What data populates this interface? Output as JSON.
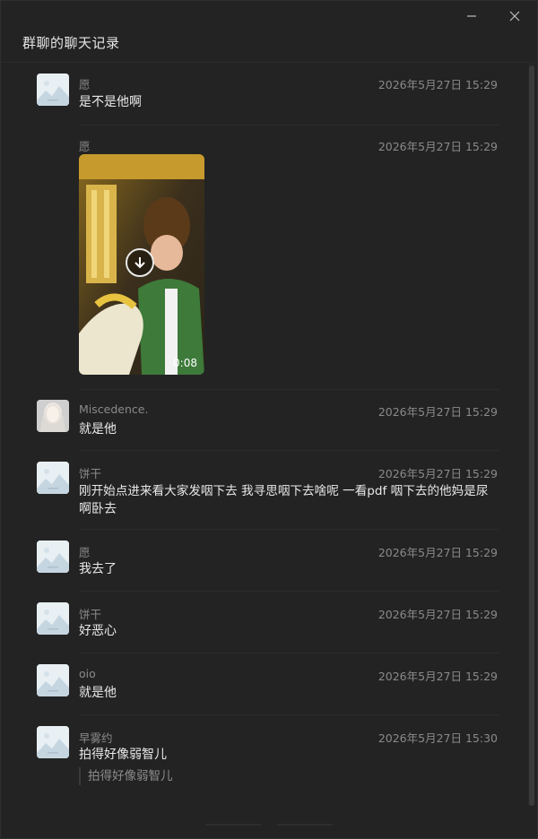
{
  "window": {
    "title": "群聊的聊天记录"
  },
  "messages": [
    {
      "sender": "愿",
      "time": "2026年5月27日 15:29",
      "text": "是不是他啊",
      "avatar": "placeholder-avatar"
    },
    {
      "sender": "愿",
      "time": "2026年5月27日 15:29",
      "video_duration": "0:08"
    },
    {
      "sender": "Miscedence.",
      "time": "2026年5月27日 15:29",
      "text": "就是他",
      "avatar": "photo-avatar"
    },
    {
      "sender": "饼干",
      "time": "2026年5月27日 15:29",
      "text_line1": "刚开始点进来看大家发咽下去 我寻思咽下去啥呢 一看pdf 咽下去的他妈是尿",
      "text_line2": "啊卧去",
      "avatar": "placeholder-avatar"
    },
    {
      "sender": "愿",
      "time": "2026年5月27日 15:29",
      "text": "我去了",
      "avatar": "placeholder-avatar"
    },
    {
      "sender": "饼干",
      "time": "2026年5月27日 15:29",
      "text": "好恶心",
      "avatar": "placeholder-avatar"
    },
    {
      "sender": "oio",
      "time": "2026年5月27日 15:29",
      "text": "就是他",
      "avatar": "placeholder-avatar"
    },
    {
      "sender": "早雾约",
      "time": "2026年5月27日 15:30",
      "text": "拍得好像弱智儿",
      "quote": "拍得好像弱智儿",
      "avatar": "placeholder-avatar"
    }
  ],
  "colors": {
    "background": "#232323",
    "text": "#e8e8e8",
    "meta": "#8a8a8a"
  }
}
